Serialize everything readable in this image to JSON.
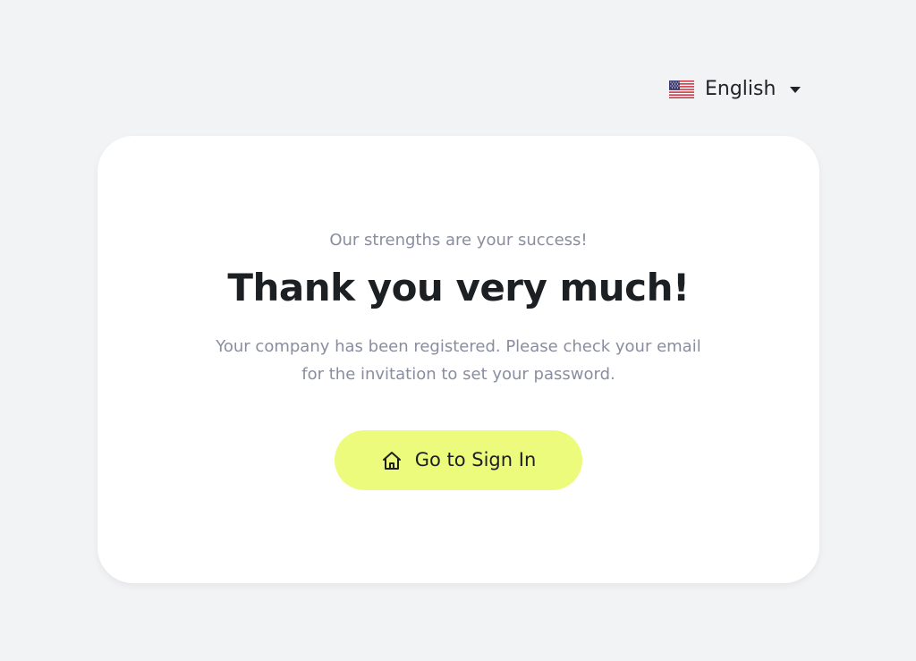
{
  "language_selector": {
    "flag_icon": "us-flag-icon",
    "label": "English",
    "caret_icon": "caret-down-icon"
  },
  "card": {
    "tagline": "Our strengths are your success!",
    "heading": "Thank you very much!",
    "message": "Your company has been registered. Please check your email for the invitation to set your password.",
    "button": {
      "icon": "home-icon",
      "label": "Go to Sign In"
    }
  },
  "colors": {
    "page_background": "#f2f3f5",
    "card_background": "#ffffff",
    "button_background": "#ecfb7c",
    "heading_text": "#1c2023",
    "muted_text": "#8a8d9f"
  }
}
